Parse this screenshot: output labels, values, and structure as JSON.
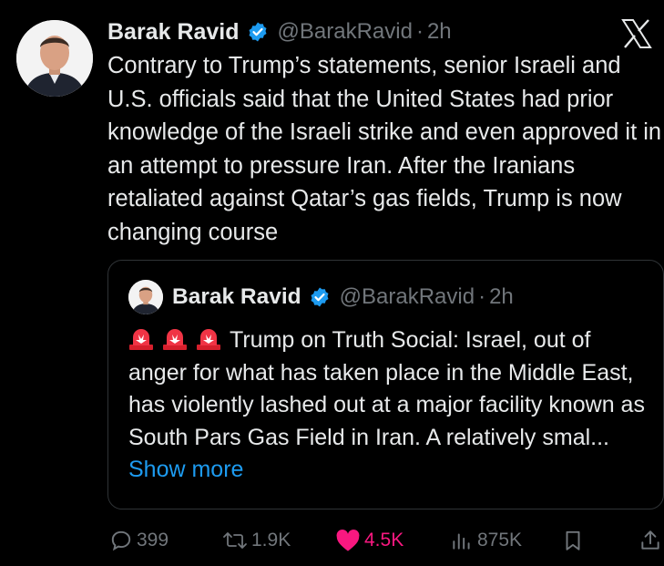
{
  "author": {
    "name": "Barak Ravid",
    "handle": "@BarakRavid",
    "separator": "·",
    "time": "2h"
  },
  "tweet": {
    "text": "Contrary to Trump’s statements, senior Israeli and U.S. officials said that the United States had prior knowledge of the Israeli strike and even approved it in an attempt to pressure Iran. After the Iranians retaliated against Qatar’s gas fields, Trump is now changing course"
  },
  "quote": {
    "name": "Barak Ravid",
    "handle": "@BarakRavid",
    "separator": "·",
    "time": "2h",
    "text": "Trump on Truth Social: Israel, out of anger for what has taken place in the Middle East, has violently lashed out at a major facility known as South Pars Gas Field in Iran. A relatively smal...",
    "show_more": "Show more",
    "emoji_icons": [
      "siren-icon",
      "siren-icon",
      "siren-icon"
    ]
  },
  "actions": {
    "replies": "399",
    "reposts": "1.9K",
    "likes": "4.5K",
    "views": "875K"
  },
  "colors": {
    "background": "#000000",
    "text": "#e7e9ea",
    "muted": "#71767b",
    "link": "#1d9bf0",
    "like": "#f91880",
    "verified": "#1d9bf0",
    "border": "#2f3336"
  }
}
